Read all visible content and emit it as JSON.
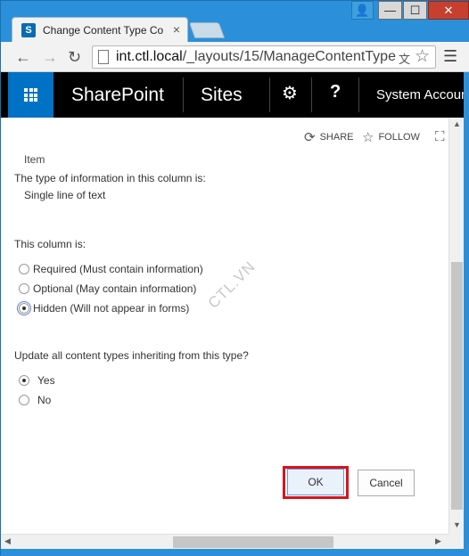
{
  "browser": {
    "tab_title": "Change Content Type Co",
    "tab_close": "×",
    "url_host": "int.ctl.local",
    "url_path": "/_layouts/15/ManageContentType",
    "window_buttons": {
      "user": "👤",
      "minimize": "—",
      "maximize": "☐",
      "close": "✕"
    }
  },
  "suite_bar": {
    "brand": "SharePoint",
    "sites": "Sites",
    "settings_icon": "⚙",
    "help_icon": "?",
    "account": "System Account"
  },
  "actions": {
    "share": "SHARE",
    "follow": "FOLLOW"
  },
  "form": {
    "item_label": "Item",
    "type_heading": "The type of information in this column is:",
    "type_value": "Single line of text",
    "column_is_heading": "This column is:",
    "column_options": [
      {
        "label": "Required (Must contain information)",
        "checked": false
      },
      {
        "label": "Optional (May contain information)",
        "checked": false
      },
      {
        "label": "Hidden (Will not appear in forms)",
        "checked": true
      }
    ],
    "update_heading": "Update all content types inheriting from this type?",
    "update_options": [
      {
        "label": "Yes",
        "checked": true
      },
      {
        "label": "No",
        "checked": false
      }
    ],
    "ok_label": "OK",
    "cancel_label": "Cancel"
  },
  "watermark": "CTL.VN",
  "colors": {
    "suite_bar": "#000000",
    "waffle": "#0072c6",
    "highlight": "#d9121d",
    "chrome": "#2b90d9"
  }
}
